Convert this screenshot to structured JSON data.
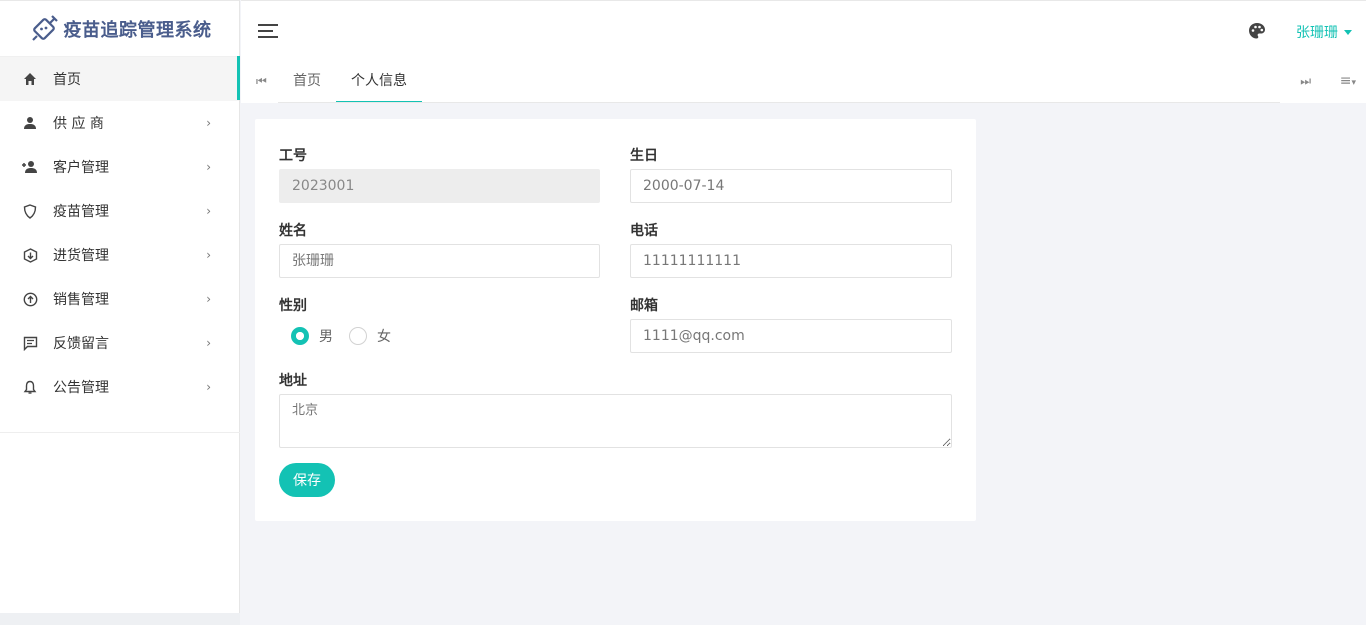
{
  "app": {
    "title": "疫苗追踪管理系统"
  },
  "colors": {
    "accent": "#13c2b4",
    "logo": "#4a5d8c"
  },
  "sidebar": {
    "items": [
      {
        "label": "首页",
        "icon": "home-icon"
      },
      {
        "label": "供 应 商",
        "icon": "user-icon"
      },
      {
        "label": "客户管理",
        "icon": "user-add-icon"
      },
      {
        "label": "疫苗管理",
        "icon": "shield-icon"
      },
      {
        "label": "进货管理",
        "icon": "download-icon"
      },
      {
        "label": "销售管理",
        "icon": "upload-icon"
      },
      {
        "label": "反馈留言",
        "icon": "message-icon"
      },
      {
        "label": "公告管理",
        "icon": "bell-icon"
      }
    ],
    "arrow": "›"
  },
  "header": {
    "user_name": "张珊珊"
  },
  "tabs": {
    "items": [
      {
        "label": "首页"
      },
      {
        "label": "个人信息"
      }
    ],
    "prev": "⏮",
    "next": "⏭",
    "menu": "≡"
  },
  "form": {
    "job_no": {
      "label": "工号",
      "value": "2023001"
    },
    "birthday": {
      "label": "生日",
      "value": "2000-07-14"
    },
    "name": {
      "label": "姓名",
      "value": "张珊珊"
    },
    "phone": {
      "label": "电话",
      "value": "11111111111"
    },
    "gender": {
      "label": "性别",
      "options": [
        "男",
        "女"
      ],
      "selected": "男"
    },
    "email": {
      "label": "邮箱",
      "value": "1111@qq.com"
    },
    "address": {
      "label": "地址",
      "value": "北京"
    },
    "save_label": "保存"
  }
}
